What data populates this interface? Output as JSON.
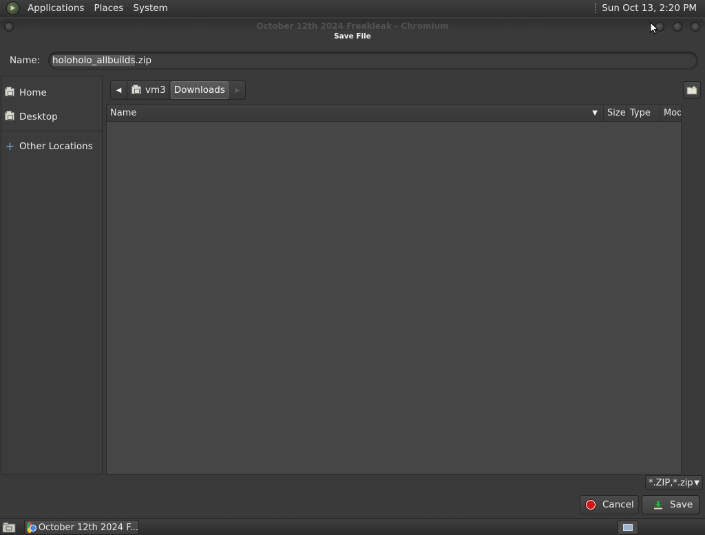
{
  "top_panel": {
    "menus": [
      "Applications",
      "Places",
      "System"
    ],
    "clock": "Sun Oct 13,  2:20 PM"
  },
  "window": {
    "title": "October 12th 2024 Freakleak - Chromium",
    "dialog_title": "Save File"
  },
  "name_field": {
    "label": "Name:",
    "value_selected": "holoholo_allbuilds",
    "value_rest": ".zip"
  },
  "sidebar": {
    "items": [
      {
        "label": "Home",
        "icon": "home-folder-icon"
      },
      {
        "label": "Desktop",
        "icon": "desktop-folder-icon"
      }
    ],
    "other_locations": "Other Locations"
  },
  "path_bar": {
    "crumbs": [
      "vm3",
      "Downloads"
    ],
    "active": "Downloads"
  },
  "file_list": {
    "columns": [
      "Name",
      "Size",
      "Type",
      "Modif"
    ],
    "rows": []
  },
  "filter": {
    "selected": "*.ZIP,*.zip"
  },
  "buttons": {
    "cancel": "Cancel",
    "save": "Save"
  },
  "taskbar": {
    "task_label": "October 12th 2024 F..."
  },
  "colors": {
    "background": "#3a3a3a",
    "cancel_red": "#d01818",
    "save_green": "#3aa845"
  }
}
